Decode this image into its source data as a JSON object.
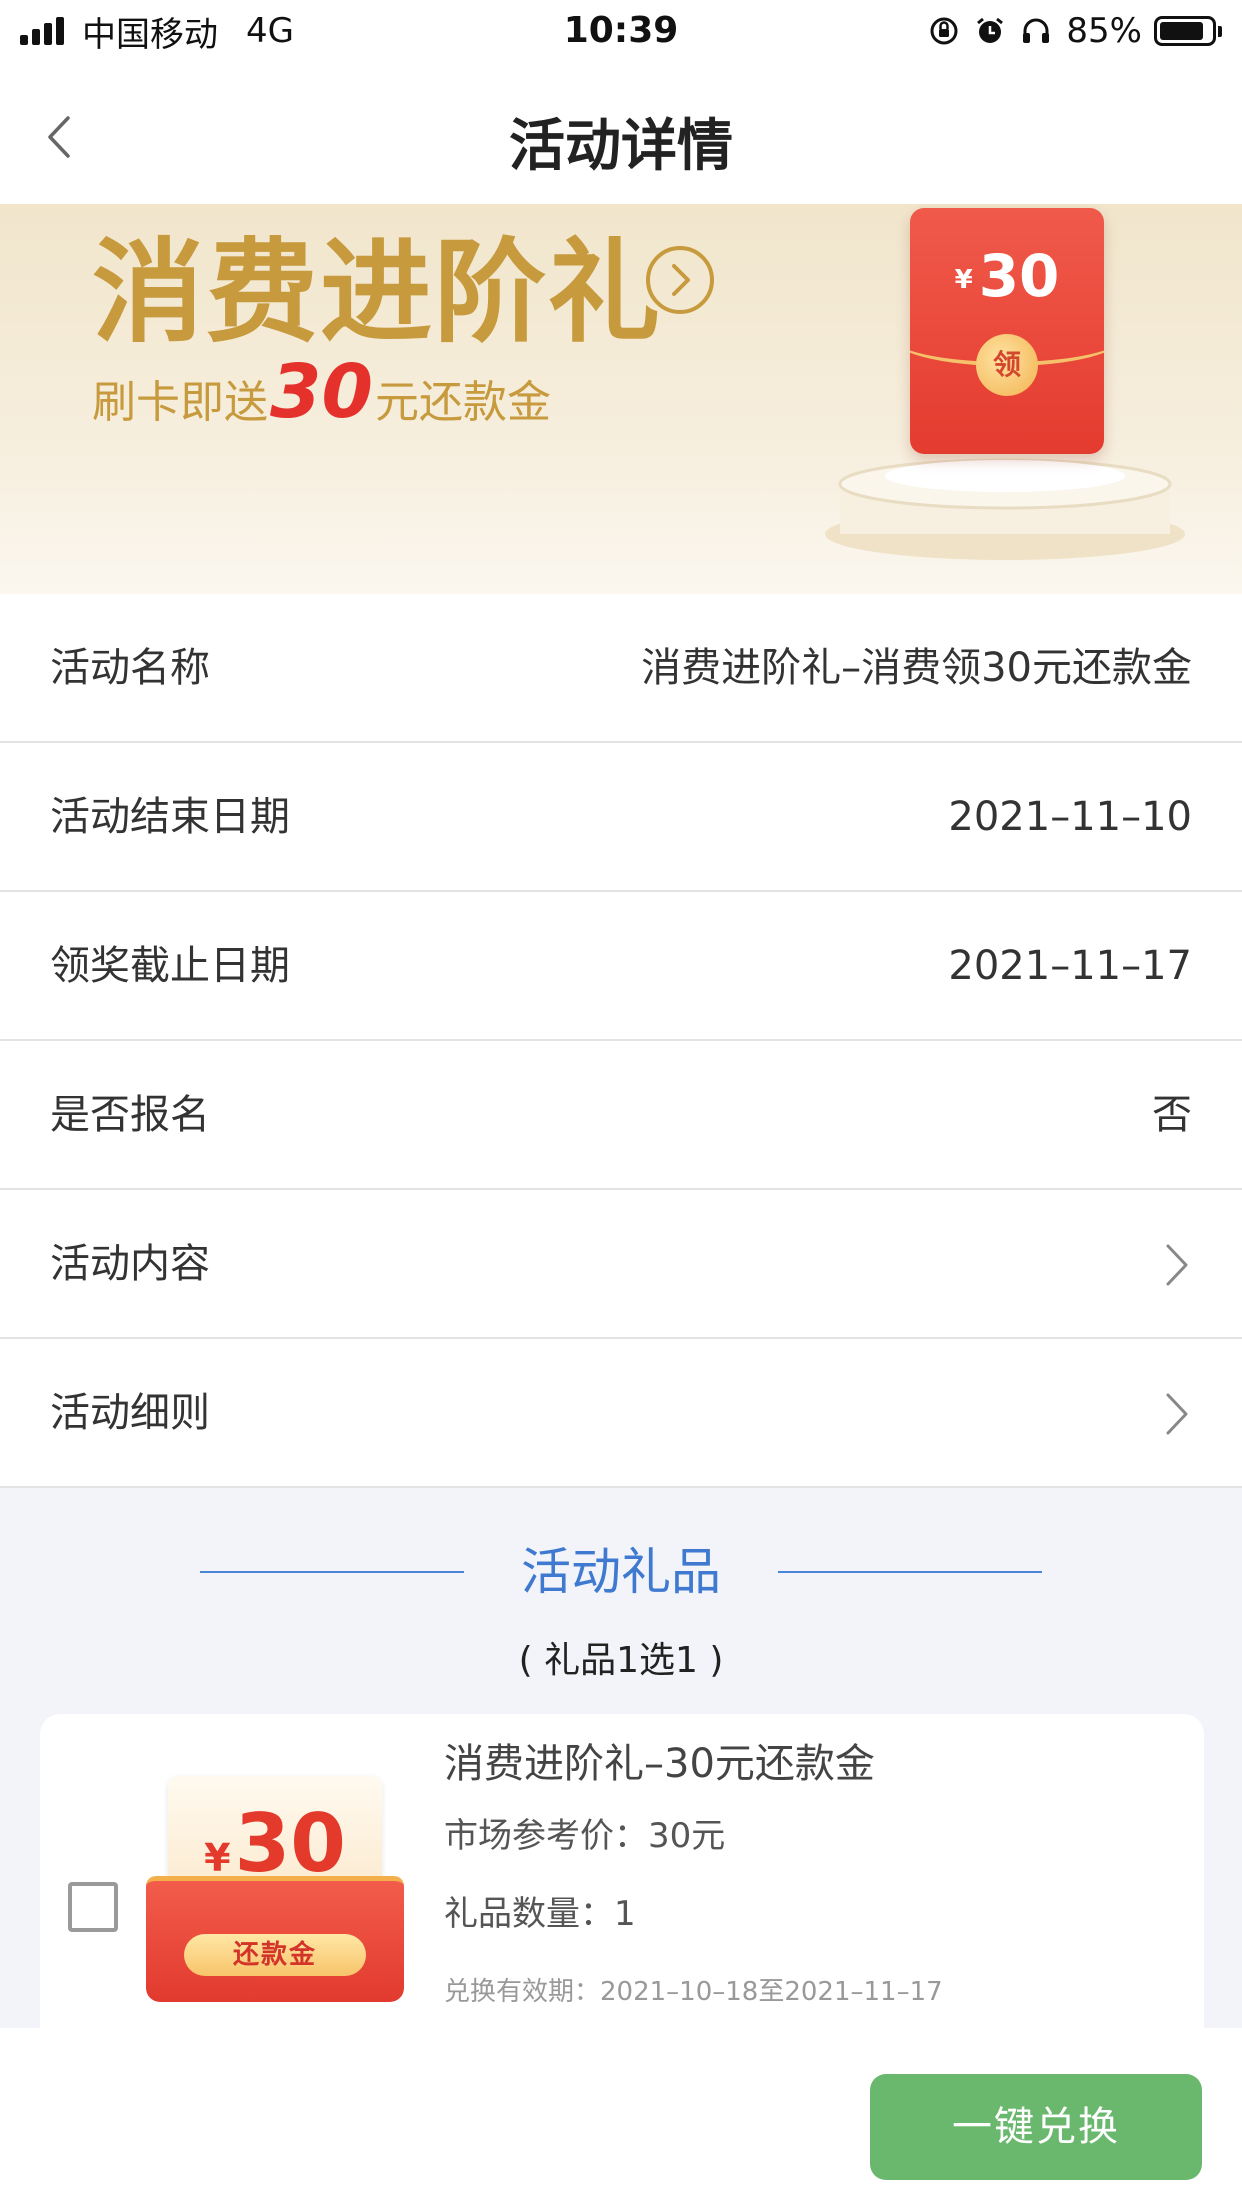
{
  "status_bar": {
    "carrier": "中国移动",
    "network": "4G",
    "time": "10:39",
    "battery_percent": "85%",
    "battery_level": 0.85,
    "icons": [
      "signal-icon",
      "orientation-lock-icon",
      "alarm-icon",
      "headphones-icon",
      "battery-icon"
    ]
  },
  "nav": {
    "title": "活动详情",
    "back_icon": "chevron-left-icon"
  },
  "banner": {
    "title": "消费进阶礼",
    "subtitle_prefix": "刷卡即送",
    "subtitle_number": "30",
    "subtitle_suffix": "元还款金",
    "envelope_currency": "¥",
    "envelope_amount": "30",
    "envelope_seal": "领",
    "arrow_icon": "circle-chevron-right-icon",
    "colors": {
      "gold": "#c79a3e",
      "red": "#e5312c"
    }
  },
  "info": {
    "rows": [
      {
        "label": "活动名称",
        "value": "消费进阶礼–消费领30元还款金"
      },
      {
        "label": "活动结束日期",
        "value": "2021–11–10"
      },
      {
        "label": "领奖截止日期",
        "value": "2021–11–17"
      },
      {
        "label": "是否报名",
        "value": "否"
      },
      {
        "label": "活动内容",
        "value": ""
      },
      {
        "label": "活动细则",
        "value": ""
      }
    ]
  },
  "gifts": {
    "heading": "活动礼品",
    "note": "( 礼品1选1 )",
    "items": [
      {
        "name": "消费进阶礼–30元还款金",
        "market_price": "市场参考价：30元",
        "quantity": "礼品数量：1",
        "validity": "兑换有效期：2021–10–18至2021–11–17",
        "image_currency": "¥",
        "image_amount": "30",
        "image_tag": "还款金",
        "checked": false
      }
    ]
  },
  "bottom": {
    "redeem_label": "一键兑换",
    "redeem_color": "#6ab86d"
  }
}
